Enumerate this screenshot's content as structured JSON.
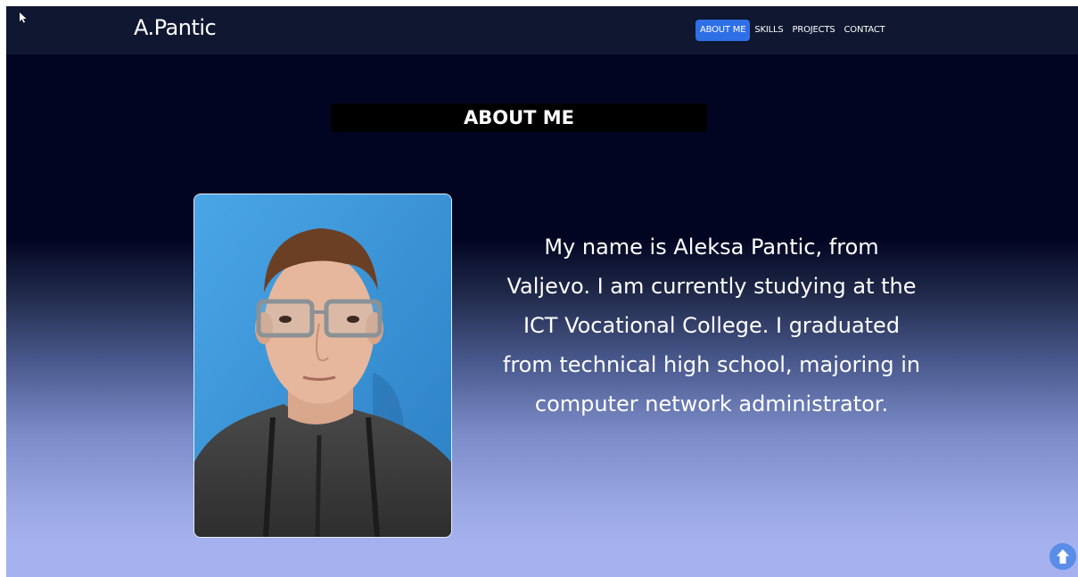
{
  "brand": "A.Pantic",
  "nav": {
    "items": [
      {
        "label": "ABOUT ME",
        "active": true
      },
      {
        "label": "SKILLS",
        "active": false
      },
      {
        "label": "PROJECTS",
        "active": false
      },
      {
        "label": "CONTACT",
        "active": false
      }
    ]
  },
  "about": {
    "title": "ABOUT ME",
    "bio": "My name is Aleksa Pantic, from Valjevo. I am currently studying at the ICT Vocational College. I graduated from technical high school, majoring in computer network administrator."
  },
  "icons": {
    "cursor": "mouse-pointer-icon",
    "scroll_top": "arrow-up-circle-icon"
  },
  "colors": {
    "navbar_bg": "#0f1731",
    "active_nav": "#2f6fe6",
    "page_top": "#020522",
    "page_bottom": "#a4b1ee",
    "scroll_button": "#5a8de8"
  }
}
